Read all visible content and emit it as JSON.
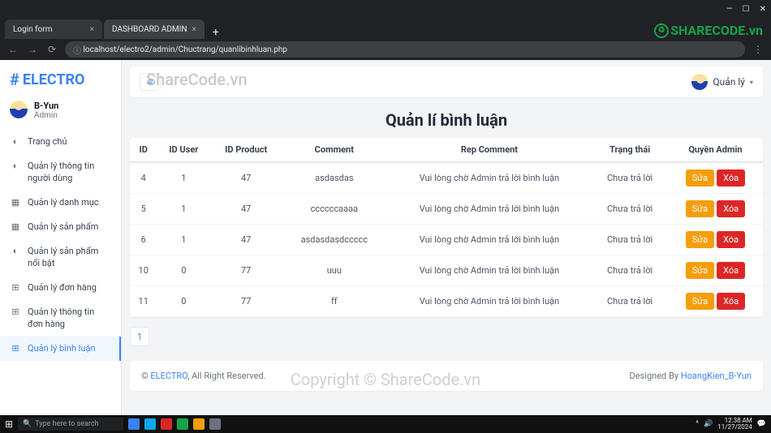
{
  "browser": {
    "tabs": [
      {
        "title": "Login form"
      },
      {
        "title": "DASHBOARD ADMIN"
      }
    ],
    "url": "localhost/electro2/admin/Chuctrang/quanlibinhluan.php",
    "newtab": "+"
  },
  "brand": {
    "hash": "#",
    "name": "ELECTRO"
  },
  "user": {
    "name": "B-Yun",
    "role": "Admin"
  },
  "topbar": {
    "menu_icon": "≡",
    "user_label": "Quản lý",
    "caret": "▾"
  },
  "sidebar": {
    "items": [
      {
        "icon": "◐",
        "label": "Trang chủ"
      },
      {
        "icon": "◐",
        "label": "Quản lý thông tin người dùng"
      },
      {
        "icon": "▦",
        "label": "Quản lý danh mục"
      },
      {
        "icon": "▦",
        "label": "Quản lý sản phẩm"
      },
      {
        "icon": "◐",
        "label": "Quản lý sản phẩm nổi bật"
      },
      {
        "icon": "⊞",
        "label": "Quản lý đơn hàng"
      },
      {
        "icon": "⊞",
        "label": "Quản lý thông tin đơn hàng"
      },
      {
        "icon": "⊞",
        "label": "Quản lý bình luận"
      }
    ]
  },
  "page": {
    "title": "Quản lí bình luận"
  },
  "table": {
    "headers": [
      "ID",
      "ID User",
      "ID Product",
      "Comment",
      "Rep Comment",
      "Trạng thái",
      "Quyền Admin"
    ],
    "edit_label": "Sửa",
    "delete_label": "Xóa",
    "rows": [
      {
        "id": "4",
        "id_user": "1",
        "id_product": "47",
        "comment": "asdasdas",
        "rep": "Vui lòng chờ Admin trả lời bình luận",
        "status": "Chưa trả lời"
      },
      {
        "id": "5",
        "id_user": "1",
        "id_product": "47",
        "comment": "ccccccaaaa",
        "rep": "Vui lòng chờ Admin trả lời bình luận",
        "status": "Chưa trả lời"
      },
      {
        "id": "6",
        "id_user": "1",
        "id_product": "47",
        "comment": "asdasdasdccccc",
        "rep": "Vui lòng chờ Admin trả lời bình luận",
        "status": "Chưa trả lời"
      },
      {
        "id": "10",
        "id_user": "0",
        "id_product": "77",
        "comment": "uuu",
        "rep": "Vui lòng chờ Admin trả lời bình luận",
        "status": "Chưa trả lời"
      },
      {
        "id": "11",
        "id_user": "0",
        "id_product": "77",
        "comment": "ff",
        "rep": "Vui lòng chờ Admin trả lời bình luận",
        "status": "Chưa trả lời"
      }
    ]
  },
  "pagination": {
    "current": "1"
  },
  "footer": {
    "copy": "©",
    "brand": "ELECTRO",
    "rights": ", All Right Reserved.",
    "designed": "Designed By ",
    "author": "HoangKien_B-Yun"
  },
  "watermarks": {
    "wm1": "ShareCode.vn",
    "wm2": "Copyright © ShareCode.vn",
    "logo_text": "SHARECODE.vn"
  },
  "taskbar": {
    "start": "⊞",
    "search_placeholder": "Type here to search",
    "time": "12:38 AM",
    "date": "11/27/2024"
  }
}
